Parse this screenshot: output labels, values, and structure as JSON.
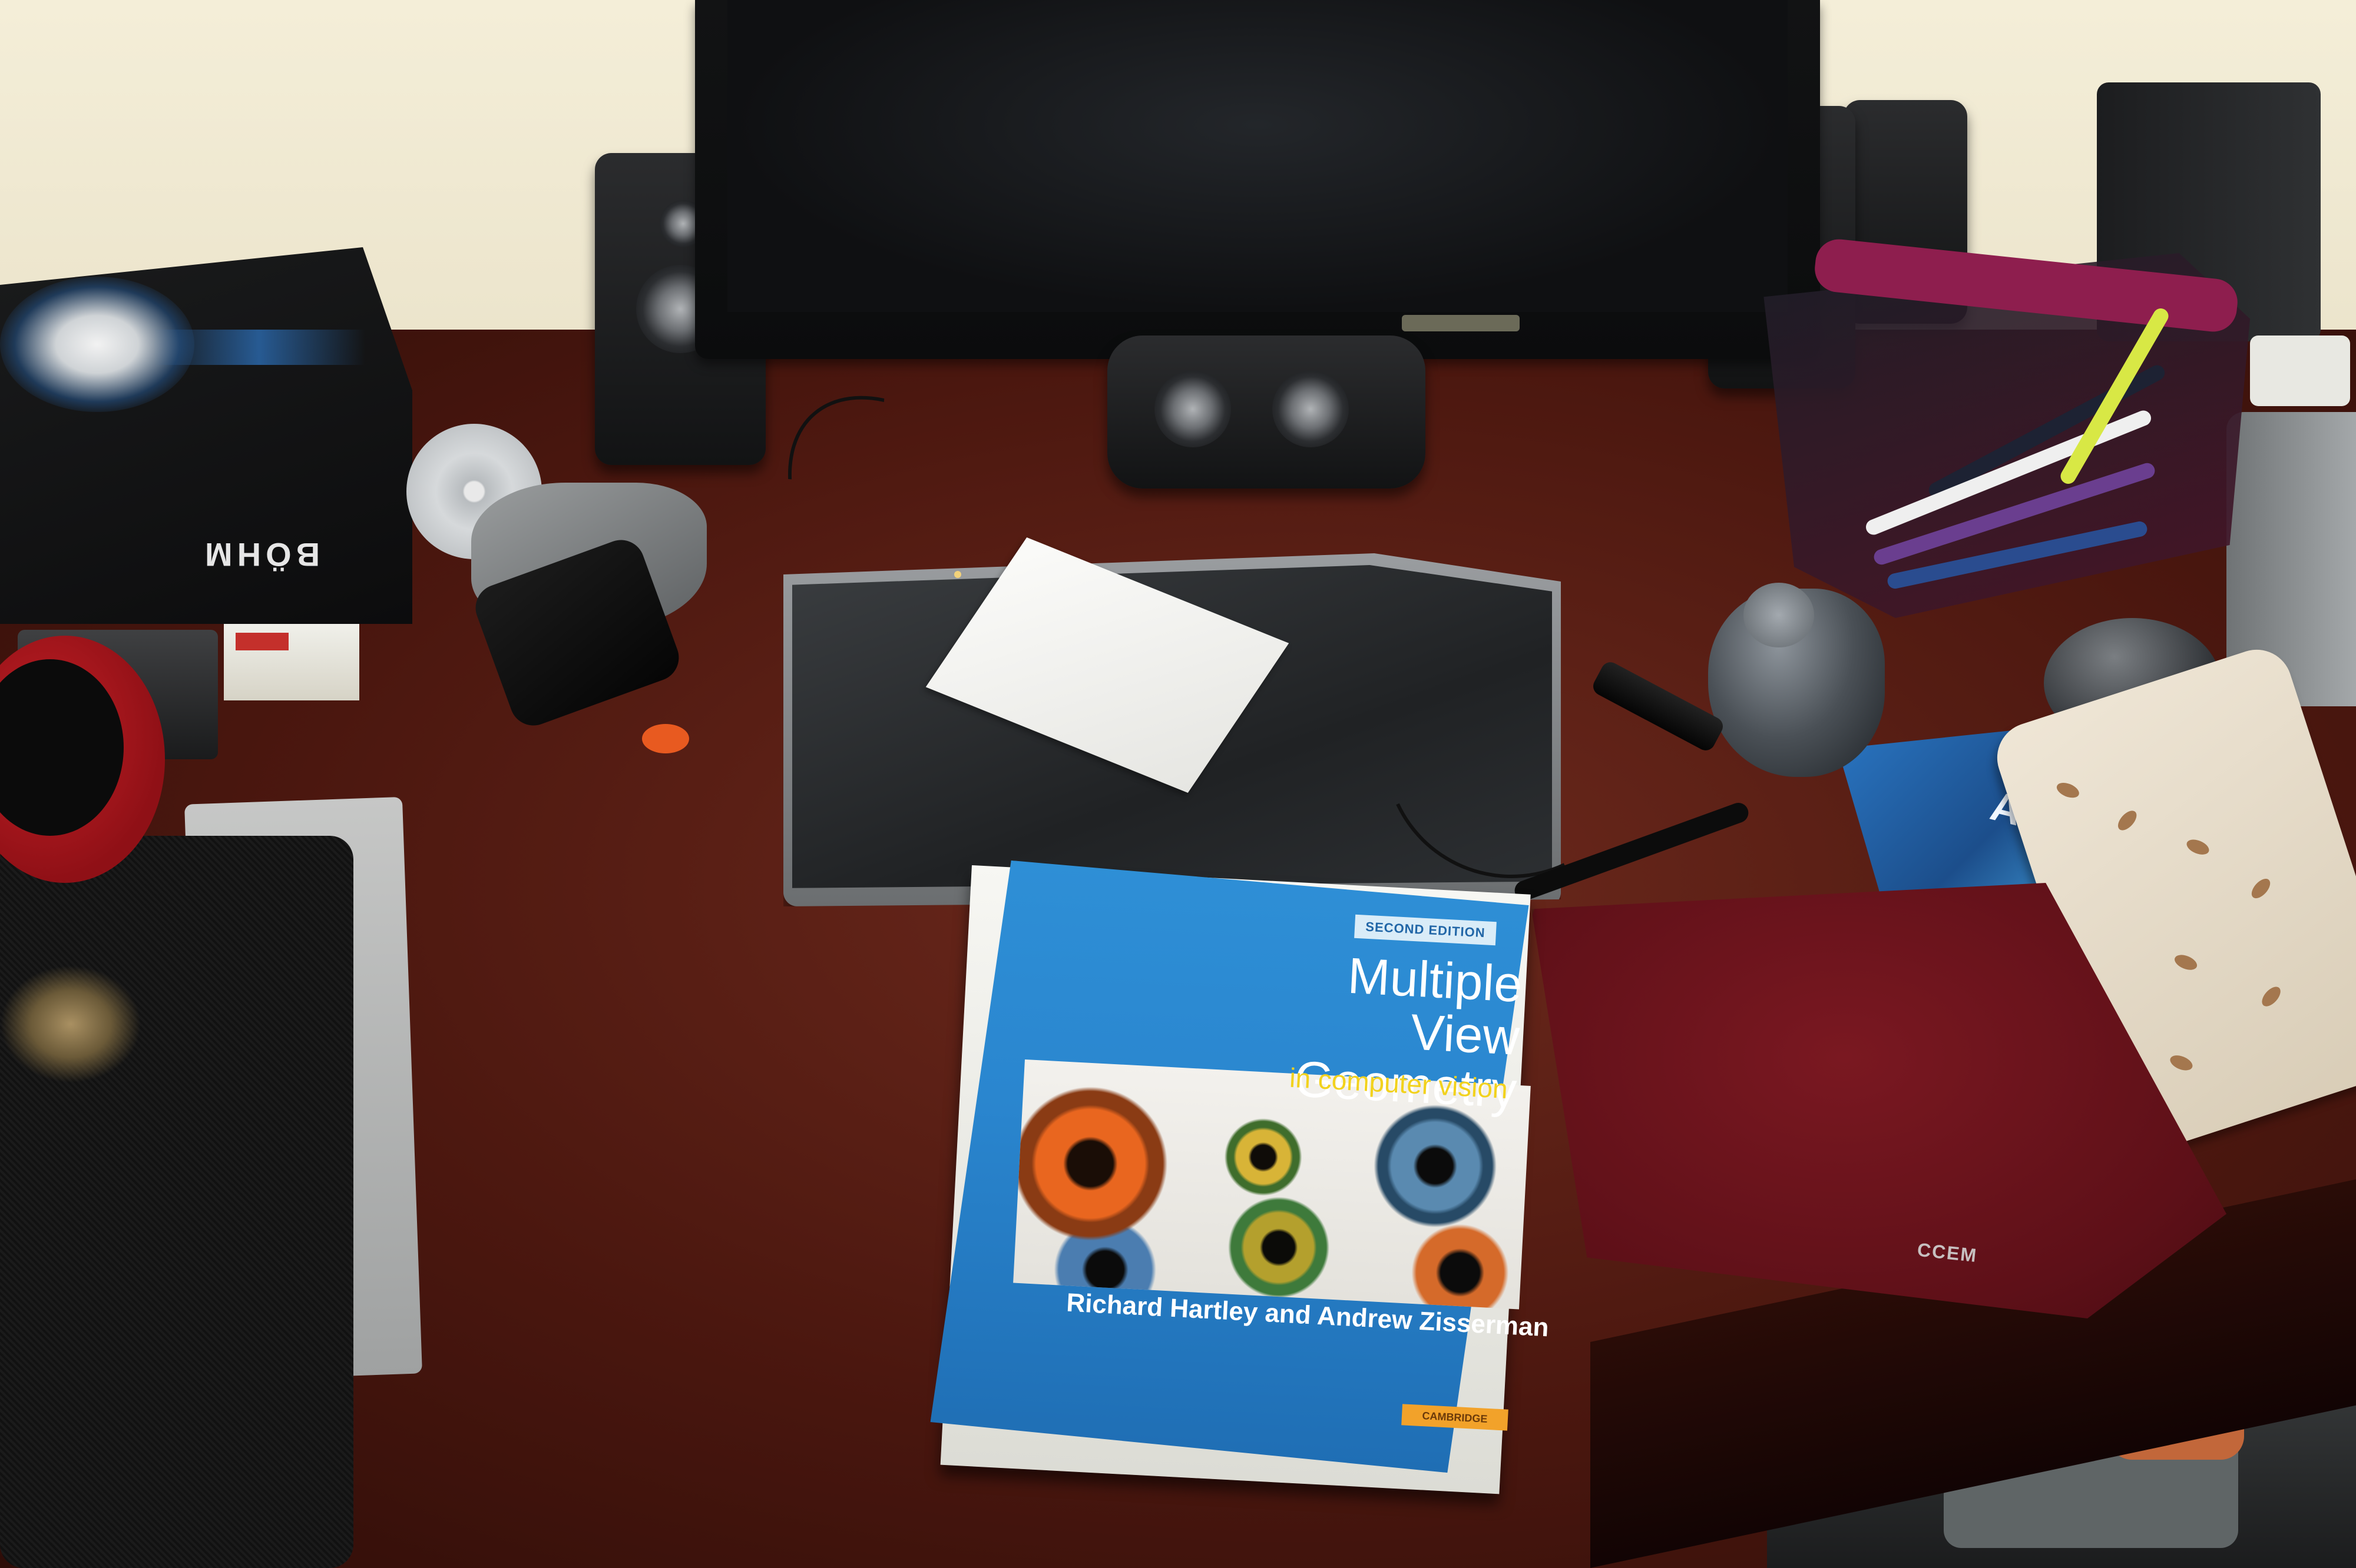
{
  "scene": "desk photo",
  "book": {
    "edition": "SECOND EDITION",
    "title_line1": "Multiple View",
    "title_line2": "Geometry",
    "subtitle": "in computer vision",
    "authors": "Richard Hartley and Andrew Zisserman",
    "publisher": "CAMBRIDGE",
    "cover_color": "#2a86cf",
    "subtitle_color": "#f2d21d"
  },
  "box": {
    "brand": "BÖHM"
  },
  "mousepad": {
    "logo": "CCEM",
    "color": "#6b121b"
  },
  "flyer": {
    "visible_text": "AO"
  }
}
